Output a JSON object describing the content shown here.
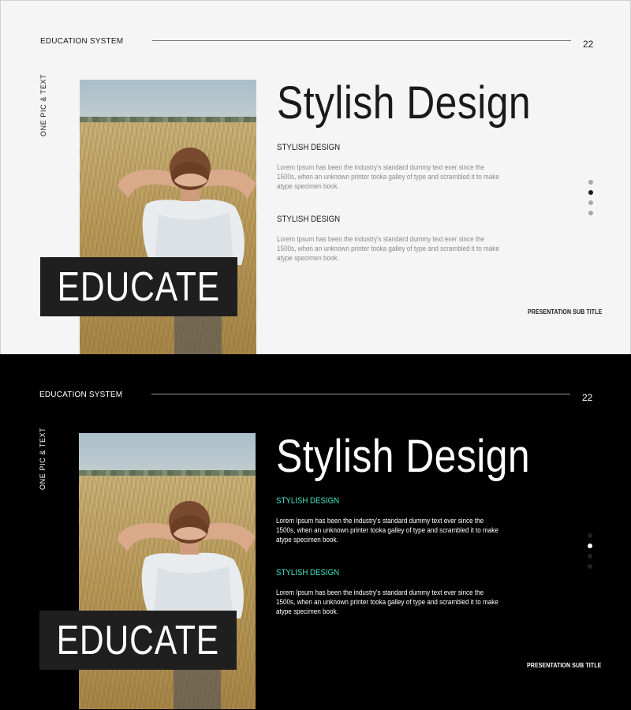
{
  "slides": [
    {
      "theme": "light",
      "brand": "EDUCATION SYSTEM",
      "page_number": "22",
      "vertical_label": "ONE PIC & TEXT",
      "overlay_word": "EDUCATE",
      "headline": "Stylish Design",
      "sections": [
        {
          "heading": "STYLISH DESIGN",
          "body": "Lorem Ipsum has been the industry's standard dummy text ever since the 1500s, when an unknown printer tooka galley of type and scrambled it to make atype specimen book."
        },
        {
          "heading": "STYLISH DESIGN",
          "body": "Lorem Ipsum has been the industry's standard dummy text ever since the 1500s, when an unknown printer tooka galley of type and scrambled it to make atype specimen book."
        }
      ],
      "presentation_subtitle": "PRESENTATION SUB TITLE",
      "active_dot": 2,
      "dot_count": 4
    },
    {
      "theme": "dark",
      "brand": "EDUCATION SYSTEM",
      "page_number": "22",
      "vertical_label": "ONE PIC & TEXT",
      "overlay_word": "EDUCATE",
      "headline": "Stylish Design",
      "sections": [
        {
          "heading": "STYLISH DESIGN",
          "body": "Lorem Ipsum has been the industry's standard dummy text ever since the 1500s, when an unknown printer tooka galley of type and scrambled it to make atype specimen book."
        },
        {
          "heading": "STYLISH DESIGN",
          "body": "Lorem Ipsum has been the industry's standard dummy text ever since the 1500s, when an unknown printer tooka galley of type and scrambled it to make atype specimen book."
        }
      ],
      "presentation_subtitle": "PRESENTATION SUB TITLE",
      "active_dot": 2,
      "dot_count": 4
    }
  ],
  "colors": {
    "light_background": "#f5f5f5",
    "dark_background": "#000000",
    "accent_teal": "#3fe0c6",
    "overlay_box": "#1f1f1f"
  }
}
